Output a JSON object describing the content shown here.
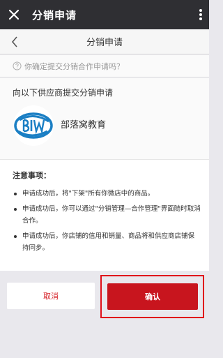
{
  "window": {
    "title": "分销申请",
    "close_icon": "close-icon",
    "menu_icon": "more-vertical-icon"
  },
  "nav": {
    "title": "分销申请",
    "back_icon": "chevron-left-icon"
  },
  "confirm_prompt": {
    "text": "你确定提交分销合作申请吗？",
    "icon": "question-circle-icon"
  },
  "supplier": {
    "intro": "向以下供应商提交分销申请",
    "logo_icon": "biw-logo",
    "name": "部落窝教育"
  },
  "notes": {
    "title": "注意事项：",
    "items": [
      "申请成功后，将\"下架\"所有你微店中的商品。",
      "申请成功后，你可以通过\"分销管理—合作管理\"界面随时取消合作。",
      "申请成功后，你店铺的信用和销量、商品将和供应商店铺保持同步。"
    ]
  },
  "actions": {
    "cancel_label": "取消",
    "confirm_label": "确认"
  },
  "colors": {
    "topbar": "#2f2f33",
    "accent": "#c8151e",
    "highlight_border": "#e0101a",
    "background": "#e9e8ed"
  }
}
